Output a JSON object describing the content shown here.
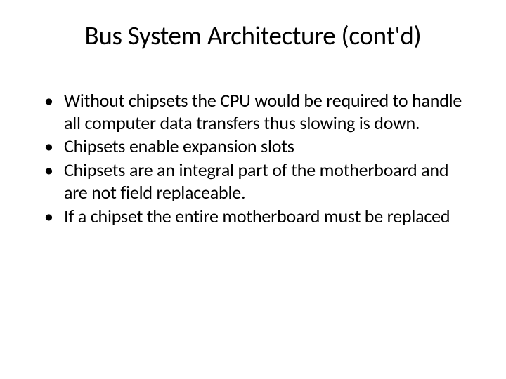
{
  "slide": {
    "title": "Bus System Architecture (cont'd)",
    "bullets": [
      "Without chipsets the CPU would be required to handle all computer data transfers thus slowing is down.",
      "Chipsets enable expansion slots",
      "Chipsets are an integral part of the motherboard and are not field replaceable.",
      "If a chipset the entire motherboard must be replaced"
    ]
  }
}
